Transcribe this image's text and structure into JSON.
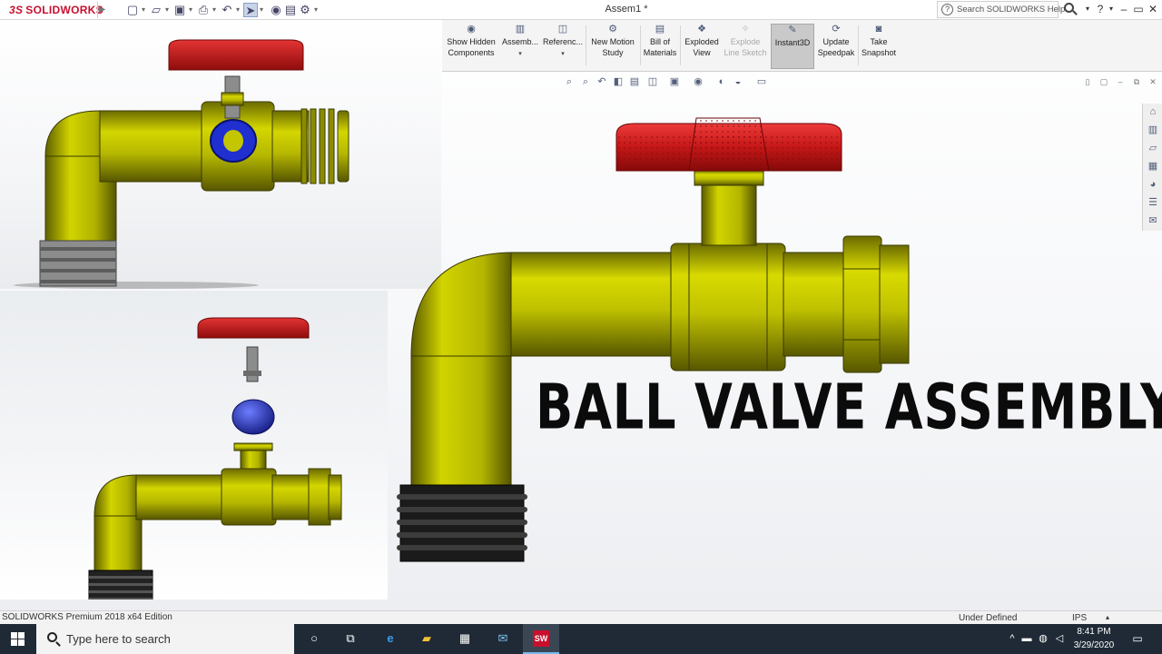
{
  "titlebar": {
    "app_name": "SOLIDWORKS",
    "brand_mark": "3S",
    "document_title": "Assem1 *",
    "help_search_placeholder": "Search SOLIDWORKS Help",
    "help_glyph": "?",
    "quick_access_icons": [
      "new-document-icon",
      "open-document-icon",
      "save-icon",
      "print-icon",
      "undo-icon",
      "select-icon",
      "rebuild-icon",
      "file-properties-icon",
      "options-icon"
    ],
    "window_buttons": [
      "help-menu",
      "minimize",
      "restore",
      "close"
    ],
    "brand_color": "#c8102e"
  },
  "commands": [
    {
      "label_line1": "Show Hidden",
      "label_line2": "Components",
      "icon": "show-hidden-icon",
      "enabled": true,
      "has_dropdown": false
    },
    {
      "label_line1": "Assemb...",
      "label_line2": "",
      "icon": "assembly-features-icon",
      "enabled": true,
      "has_dropdown": true
    },
    {
      "label_line1": "Referenc...",
      "label_line2": "",
      "icon": "reference-geometry-icon",
      "enabled": true,
      "has_dropdown": true
    },
    {
      "label_line1": "New Motion",
      "label_line2": "Study",
      "icon": "motion-study-icon",
      "enabled": true,
      "has_dropdown": false
    },
    {
      "label_line1": "Bill of",
      "label_line2": "Materials",
      "icon": "bill-of-materials-icon",
      "enabled": true,
      "has_dropdown": false
    },
    {
      "label_line1": "Exploded",
      "label_line2": "View",
      "icon": "exploded-view-icon",
      "enabled": true,
      "has_dropdown": false
    },
    {
      "label_line1": "Explode",
      "label_line2": "Line Sketch",
      "icon": "explode-line-sketch-icon",
      "enabled": false,
      "has_dropdown": false
    },
    {
      "label_line1": "Instant3D",
      "label_line2": "",
      "icon": "instant3d-icon",
      "enabled": true,
      "active": true,
      "has_dropdown": false
    },
    {
      "label_line1": "Update",
      "label_line2": "Speedpak",
      "icon": "update-speedpak-icon",
      "enabled": true,
      "has_dropdown": false
    },
    {
      "label_line1": "Take",
      "label_line2": "Snapshot",
      "icon": "snapshot-icon",
      "enabled": true,
      "has_dropdown": false
    }
  ],
  "heads_up_toolbar": [
    "zoom-to-fit-icon",
    "zoom-to-area-icon",
    "previous-view-icon",
    "section-view-icon",
    "dynamic-annotation-icon",
    "view-orientation-icon",
    "display-style-icon",
    "hide-show-items-icon",
    "edit-appearance-icon",
    "apply-scene-icon",
    "view-settings-icon"
  ],
  "task_pane": [
    "home-icon",
    "design-library-icon",
    "file-explorer-icon",
    "view-palette-icon",
    "appearances-icon",
    "custom-properties-icon",
    "forum-icon"
  ],
  "overlay_title": "BALL VALVE ASSEMBLY",
  "model_colors": {
    "body": "#c3c600",
    "body_dark": "#4a4a00",
    "handle": "#c21414",
    "ball": "#1f2fd0",
    "stem": "#8a8a8a",
    "thread": "#1a1a1a",
    "nut_grey": "#8c8c8c"
  },
  "statusbar": {
    "product_text": "SOLIDWORKS Premium 2018 x64 Edition",
    "state": "Under Defined",
    "units": "IPS"
  },
  "taskbar": {
    "search_placeholder": "Type here to search",
    "pinned_icons": [
      "cortana-icon",
      "task-view-icon",
      "edge-icon",
      "file-explorer-icon",
      "store-icon",
      "mail-icon",
      "solidworks-icon"
    ],
    "active_app": "solidworks-icon",
    "app_glyph": "SW",
    "tray_icons": [
      "chevron-up-icon",
      "battery-icon",
      "network-icon",
      "volume-icon"
    ],
    "time": "8:41 PM",
    "date": "3/29/2020"
  }
}
